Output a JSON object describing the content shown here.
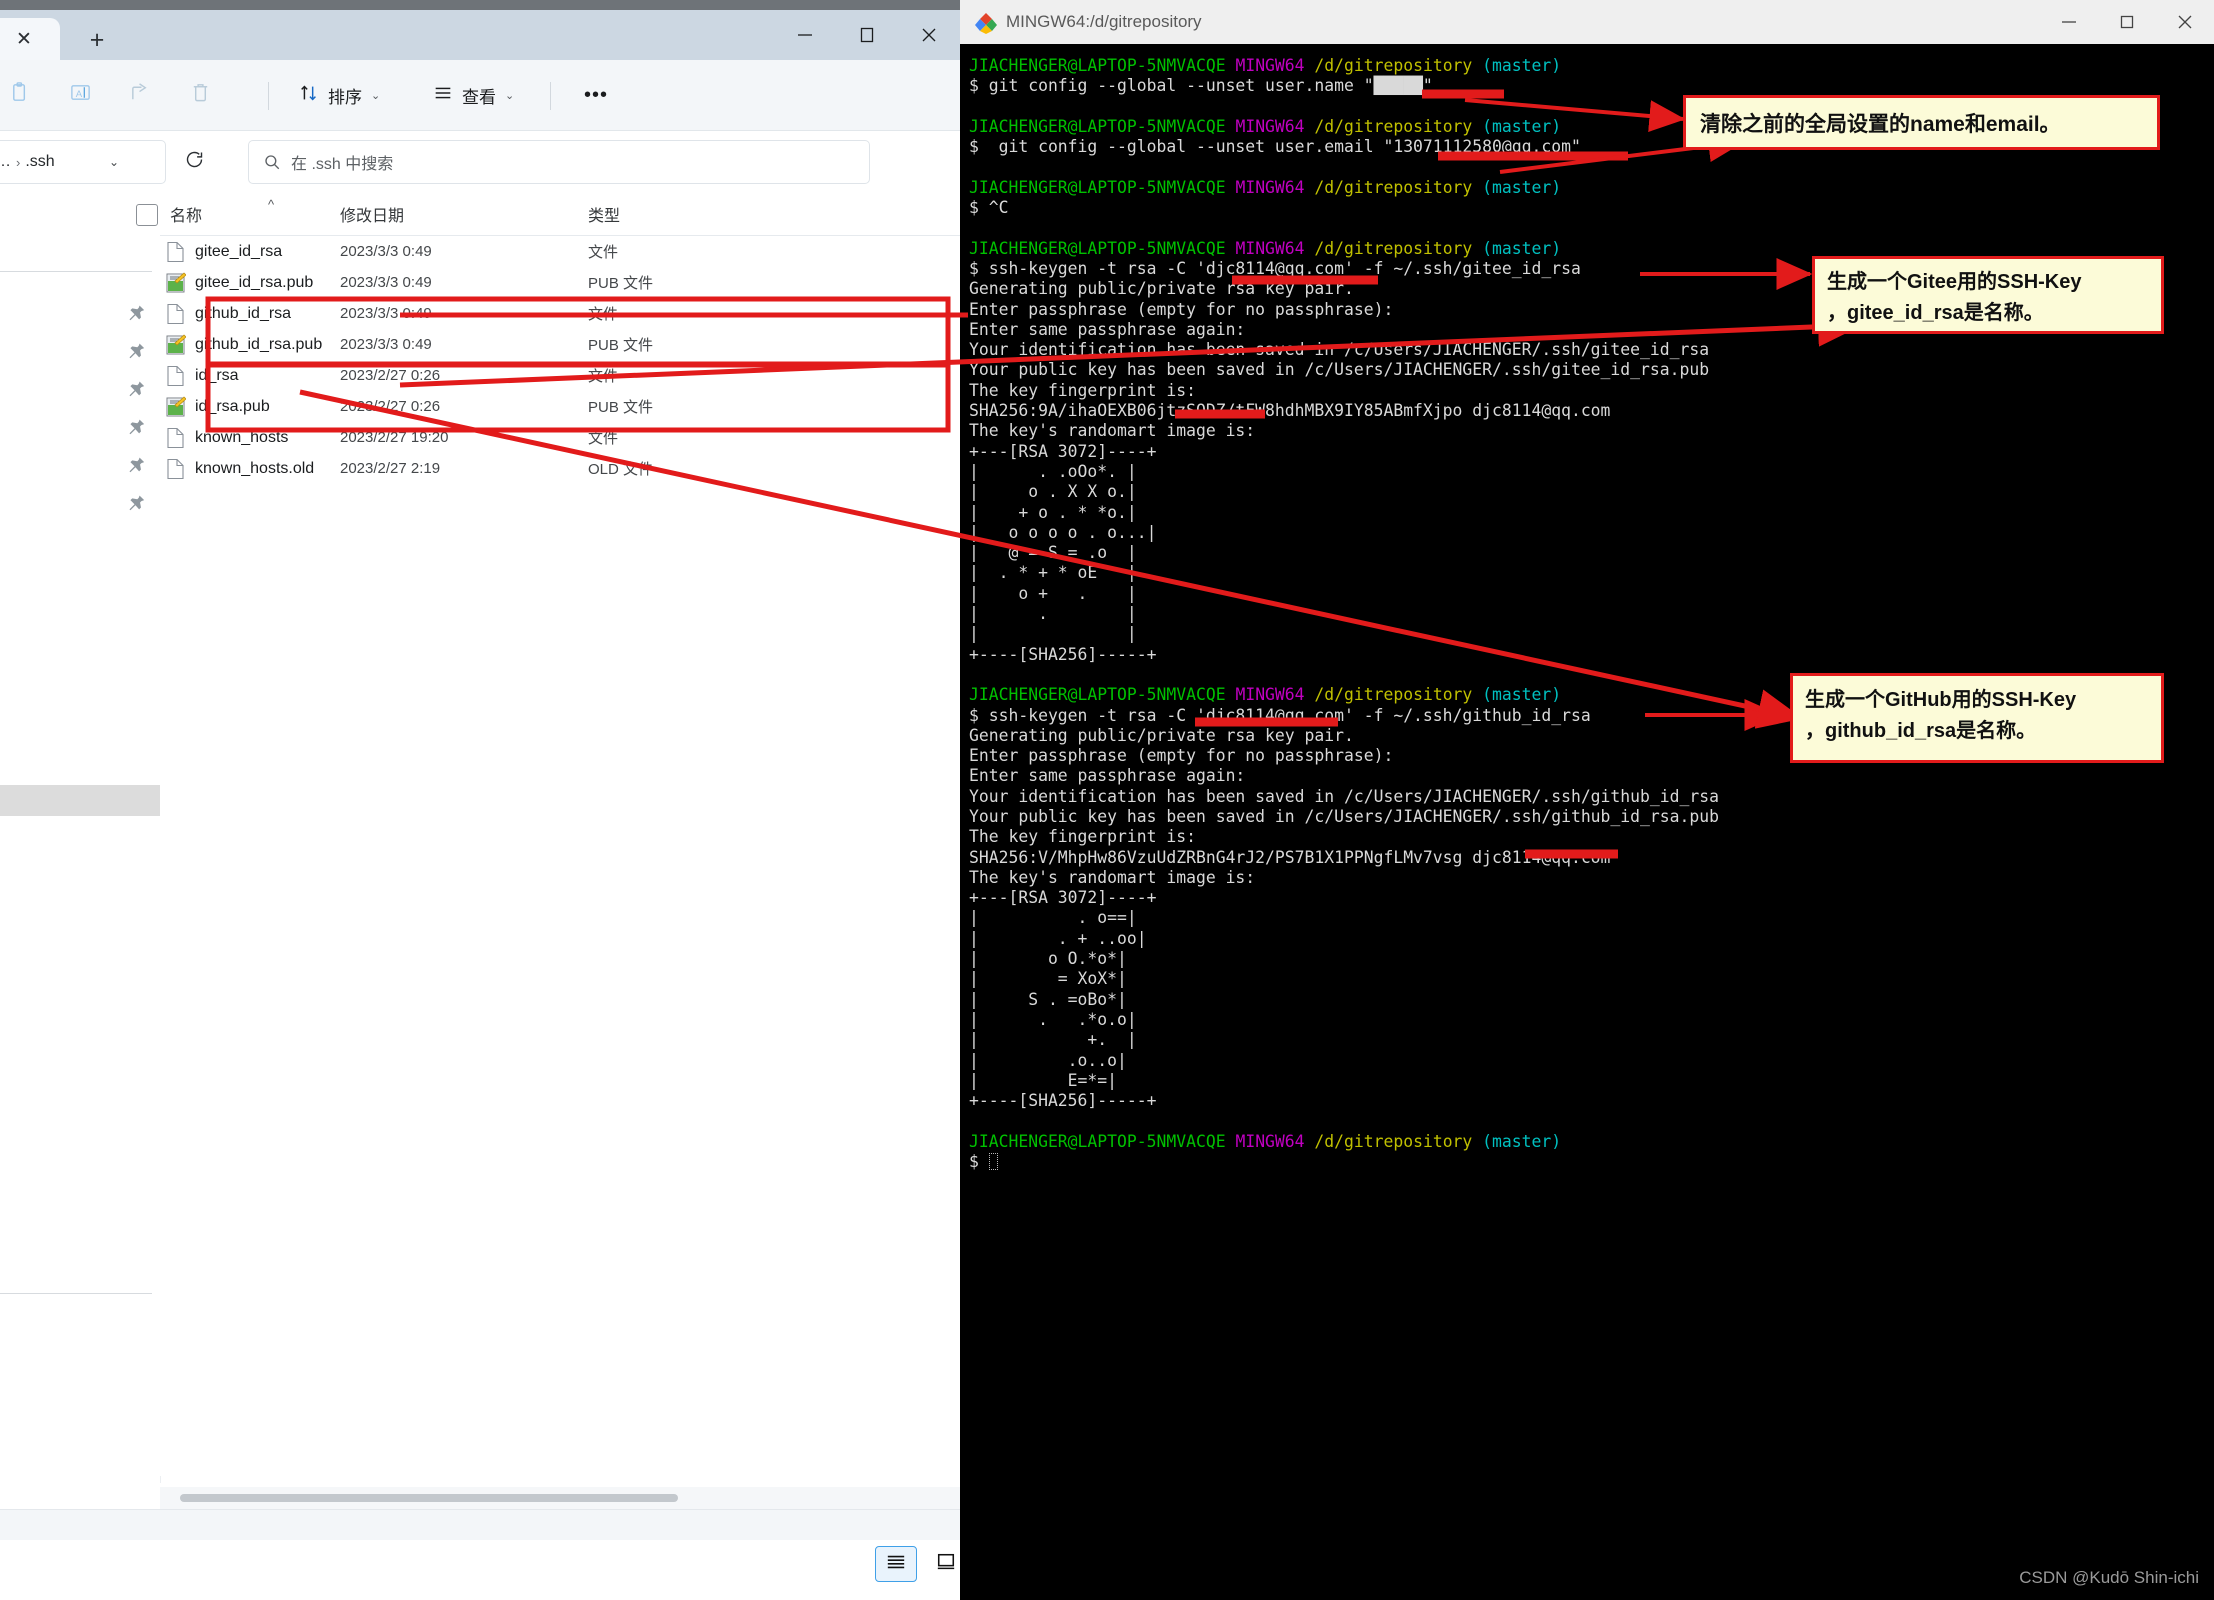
{
  "explorer": {
    "tab": {
      "close_label": "✕",
      "newtab_label": "+"
    },
    "window_controls": {
      "minimize": "minimize-icon",
      "maximize": "maximize-icon",
      "close": "close-icon"
    },
    "toolbar": {
      "items": [
        {
          "name": "paste",
          "icon": "paste-icon",
          "label": ""
        },
        {
          "name": "rename",
          "icon": "rename-icon",
          "label": ""
        },
        {
          "name": "share",
          "icon": "share-icon",
          "label": ""
        },
        {
          "name": "delete",
          "icon": "trash-icon",
          "label": ""
        }
      ],
      "sort_label": "排序",
      "view_label": "查看",
      "more_label": "•••",
      "caret": "⌄"
    },
    "address": {
      "ellipsis": "…",
      "separator": "›",
      "current_folder": ".ssh",
      "dropdown_caret": "⌄",
      "refresh_icon": "refresh-icon"
    },
    "search": {
      "placeholder": "在 .ssh 中搜索",
      "icon": "search-icon"
    },
    "columns": {
      "name": "名称",
      "date_modified": "修改日期",
      "type": "类型",
      "sort_indicator": "^"
    },
    "files": [
      {
        "name": "gitee_id_rsa",
        "date": "2023/3/3 0:49",
        "type": "文件",
        "icon": "file-icon"
      },
      {
        "name": "gitee_id_rsa.pub",
        "date": "2023/3/3 0:49",
        "type": "PUB 文件",
        "icon": "pub-file-icon"
      },
      {
        "name": "github_id_rsa",
        "date": "2023/3/3 0:49",
        "type": "文件",
        "icon": "file-icon"
      },
      {
        "name": "github_id_rsa.pub",
        "date": "2023/3/3 0:49",
        "type": "PUB 文件",
        "icon": "pub-file-icon"
      },
      {
        "name": "id_rsa",
        "date": "2023/2/27 0:26",
        "type": "文件",
        "icon": "file-icon"
      },
      {
        "name": "id_rsa.pub",
        "date": "2023/2/27 0:26",
        "type": "PUB 文件",
        "icon": "pub-file-icon"
      },
      {
        "name": "known_hosts",
        "date": "2023/2/27 19:20",
        "type": "文件",
        "icon": "file-icon"
      },
      {
        "name": "known_hosts.old",
        "date": "2023/2/27 2:19",
        "type": "OLD 文件",
        "icon": "file-icon"
      }
    ],
    "statusbar": {
      "details_view_icon": "details-view-icon",
      "large_icons_view_icon": "large-icons-view-icon"
    }
  },
  "terminal": {
    "title": "MINGW64:/d/gitrepository",
    "icon": "git-bash-icon",
    "window_controls": {
      "minimize": "minimize-icon",
      "maximize": "maximize-icon",
      "close": "close-icon"
    },
    "prompt": {
      "user_host": "JIACHENGER@LAPTOP-5NMVACQE",
      "shell": "MINGW64",
      "path": "/d/gitrepository",
      "branch": "(master)",
      "sigil": "$"
    },
    "lines": [
      {
        "type": "prompt"
      },
      {
        "type": "cmd",
        "text": "$ git config --global --unset user.name \"█████\""
      },
      {
        "type": "blank"
      },
      {
        "type": "prompt"
      },
      {
        "type": "cmd",
        "text": "$  git config --global --unset user.email \"13071112580@qq.com\""
      },
      {
        "type": "blank"
      },
      {
        "type": "prompt"
      },
      {
        "type": "cmd",
        "text": "$ ^C"
      },
      {
        "type": "blank"
      },
      {
        "type": "prompt"
      },
      {
        "type": "cmd",
        "text": "$ ssh-keygen -t rsa -C 'djc8114@qq.com' -f ~/.ssh/gitee_id_rsa"
      },
      {
        "type": "out",
        "text": "Generating public/private rsa key pair."
      },
      {
        "type": "out",
        "text": "Enter passphrase (empty for no passphrase):"
      },
      {
        "type": "out",
        "text": "Enter same passphrase again:"
      },
      {
        "type": "out",
        "text": "Your identification has been saved in /c/Users/JIACHENGER/.ssh/gitee_id_rsa"
      },
      {
        "type": "out",
        "text": "Your public key has been saved in /c/Users/JIACHENGER/.ssh/gitee_id_rsa.pub"
      },
      {
        "type": "out",
        "text": "The key fingerprint is:"
      },
      {
        "type": "out",
        "text": "SHA256:9A/ihaOEXB06jtzSODZ/tFW8hdhMBX9IY85ABmfXjpo djc8114@qq.com"
      },
      {
        "type": "out",
        "text": "The key's randomart image is:"
      },
      {
        "type": "out",
        "text": "+---[RSA 3072]----+"
      },
      {
        "type": "out",
        "text": "|      . .oOo*. |"
      },
      {
        "type": "out",
        "text": "|     o . X X o.|"
      },
      {
        "type": "out",
        "text": "|    + o . * *o.|"
      },
      {
        "type": "out",
        "text": "|   o o o o . o...|"
      },
      {
        "type": "out",
        "text": "|   @ = S = .o  |"
      },
      {
        "type": "out",
        "text": "|  . * + * oE   |"
      },
      {
        "type": "out",
        "text": "|    o +   .    |"
      },
      {
        "type": "out",
        "text": "|      .        |"
      },
      {
        "type": "out",
        "text": "|               |"
      },
      {
        "type": "out",
        "text": "+----[SHA256]-----+"
      },
      {
        "type": "blank"
      },
      {
        "type": "prompt"
      },
      {
        "type": "cmd",
        "text": "$ ssh-keygen -t rsa -C 'djc8114@qq.com' -f ~/.ssh/github_id_rsa"
      },
      {
        "type": "out",
        "text": "Generating public/private rsa key pair."
      },
      {
        "type": "out",
        "text": "Enter passphrase (empty for no passphrase):"
      },
      {
        "type": "out",
        "text": "Enter same passphrase again:"
      },
      {
        "type": "out",
        "text": "Your identification has been saved in /c/Users/JIACHENGER/.ssh/github_id_rsa"
      },
      {
        "type": "out",
        "text": "Your public key has been saved in /c/Users/JIACHENGER/.ssh/github_id_rsa.pub"
      },
      {
        "type": "out",
        "text": "The key fingerprint is:"
      },
      {
        "type": "out",
        "text": "SHA256:V/MhpHw86VzuUdZRBnG4rJ2/PS7B1X1PPNgfLMv7vsg djc8114@qq.com"
      },
      {
        "type": "out",
        "text": "The key's randomart image is:"
      },
      {
        "type": "out",
        "text": "+---[RSA 3072]----+"
      },
      {
        "type": "out",
        "text": "|          . o==|"
      },
      {
        "type": "out",
        "text": "|        . + ..oo|"
      },
      {
        "type": "out",
        "text": "|       o O.*o*|"
      },
      {
        "type": "out",
        "text": "|        = XoX*|"
      },
      {
        "type": "out",
        "text": "|     S . =oBo*|"
      },
      {
        "type": "out",
        "text": "|      .   .*o.o|"
      },
      {
        "type": "out",
        "text": "|           +.  |"
      },
      {
        "type": "out",
        "text": "|         .o..o|"
      },
      {
        "type": "out",
        "text": "|         E=*=|"
      },
      {
        "type": "out",
        "text": "+----[SHA256]-----+"
      },
      {
        "type": "blank"
      },
      {
        "type": "prompt"
      },
      {
        "type": "cursor"
      }
    ],
    "watermark": "CSDN @Kudō Shin-ichi"
  },
  "annotations": {
    "colors": {
      "box_border": "#e21b1b",
      "box_fill": "#fcfbd8",
      "arrow": "#e21b1b"
    },
    "notes": [
      {
        "id": "note-clear-config",
        "lines": [
          "清除之前的全局设置的name和email。"
        ]
      },
      {
        "id": "note-gitee-key",
        "lines": [
          "生成一个Gitee用的SSH-Key",
          "，gitee_id_rsa是名称。"
        ]
      },
      {
        "id": "note-github-key",
        "lines": [
          "生成一个GitHub用的SSH-Key",
          "，github_id_rsa是名称。"
        ]
      }
    ],
    "highlight_boxes": [
      {
        "id": "hl-gitee-pair",
        "label": "gitee key file pair highlight"
      },
      {
        "id": "hl-github-pair",
        "label": "github key file pair highlight"
      }
    ]
  }
}
